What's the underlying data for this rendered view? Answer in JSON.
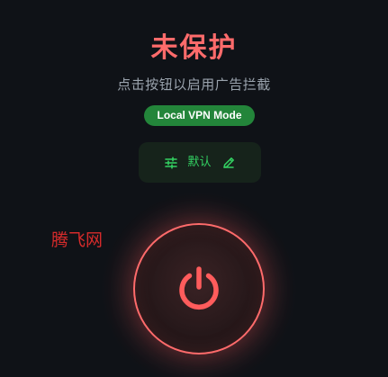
{
  "status": {
    "title": "未保护",
    "subtitle": "点击按钮以启用广告拦截",
    "mode_badge": "Local VPN Mode"
  },
  "profile_button": {
    "label": "默认",
    "left_icon": "sliders-icon",
    "right_icon": "pencil-icon"
  },
  "watermark": {
    "text": "腾飞网"
  },
  "power_button": {
    "icon": "power-icon",
    "state": "off"
  },
  "colors": {
    "background": "#0f1217",
    "accent_red": "#ff6b6b",
    "accent_green": "#33d162",
    "badge_green": "#23853a",
    "subtitle_gray": "#9aa3ad",
    "watermark_red": "#d62b2b"
  }
}
